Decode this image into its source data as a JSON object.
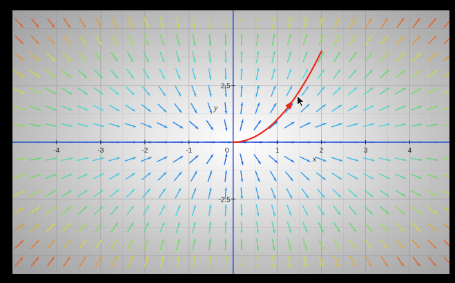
{
  "chart_data": {
    "type": "vector-field",
    "description_visible": false,
    "xlim": [
      -5.0,
      4.9
    ],
    "ylim": [
      -5.8,
      5.8
    ],
    "x_ticks": [
      {
        "value": -4,
        "label": "-4"
      },
      {
        "value": -3,
        "label": "-3"
      },
      {
        "value": -2,
        "label": "-2"
      },
      {
        "value": -1,
        "label": "-1"
      },
      {
        "value": 0,
        "label": "0"
      },
      {
        "value": 1,
        "label": "1"
      },
      {
        "value": 2,
        "label": "2"
      },
      {
        "value": 3,
        "label": "3"
      },
      {
        "value": 4,
        "label": "4"
      }
    ],
    "y_ticks": [
      {
        "value": 2.5,
        "label": "2.5"
      },
      {
        "value": -2.5,
        "label": "-2.5"
      }
    ],
    "xlabel": "x",
    "ylabel": "y",
    "grid": true,
    "field": {
      "dx": "1",
      "dy": "2y/x",
      "grid_step_x": 0.36,
      "grid_step_y": 0.75
    },
    "colors": {
      "low_magnitude": "#1f3fd0",
      "mid_magnitude": "#3ecde0",
      "high_magnitude": "#f2e53a",
      "peak_magnitude": "#e8502a",
      "trajectory": "#e8261a",
      "axes": "#2a4bd8",
      "grid": "#8f8f8f"
    },
    "trajectory": {
      "equation": "y = x^2",
      "x_range": [
        0,
        2.0
      ],
      "arrow_at_x": 1.35
    }
  },
  "cursor": {
    "icon": "mouse-pointer-icon",
    "x": 1.45,
    "y": 2.05
  }
}
